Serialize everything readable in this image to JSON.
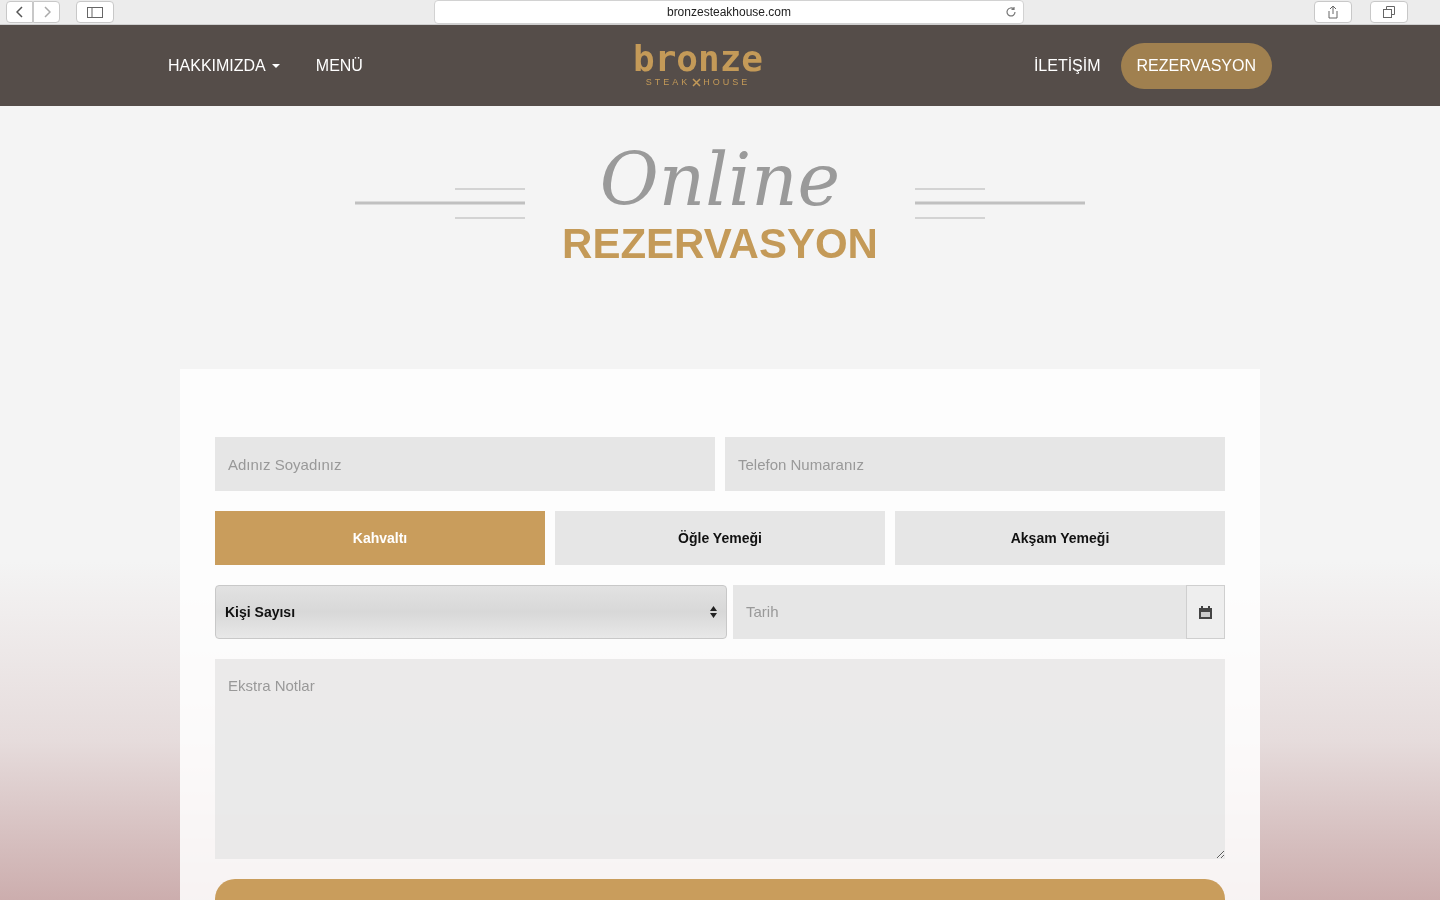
{
  "browser": {
    "url": "bronzesteakhouse.com"
  },
  "nav": {
    "left": [
      {
        "label": "HAKKIMIZDA",
        "dropdown": true
      },
      {
        "label": "MENÜ",
        "dropdown": false
      }
    ],
    "logo": {
      "name": "bronze",
      "tagline_left": "STEAK",
      "tagline_right": "HOUSE"
    },
    "right": [
      {
        "label": "İLETİŞİM",
        "kind": "link"
      },
      {
        "label": "REZERVASYON",
        "kind": "pill"
      }
    ]
  },
  "heading": {
    "script": "Online",
    "title": "REZERVASYON"
  },
  "form": {
    "name": {
      "placeholder": "Adınız Soyadınız"
    },
    "phone": {
      "placeholder": "Telefon Numaranız"
    },
    "meals": [
      {
        "label": "Kahvaltı",
        "selected": true
      },
      {
        "label": "Öğle Yemeği",
        "selected": false
      },
      {
        "label": "Akşam Yemeği",
        "selected": false
      }
    ],
    "guests": {
      "value": "Kişi Sayısı"
    },
    "date": {
      "placeholder": "Tarih"
    },
    "notes": {
      "placeholder": "Ekstra Notlar"
    }
  }
}
